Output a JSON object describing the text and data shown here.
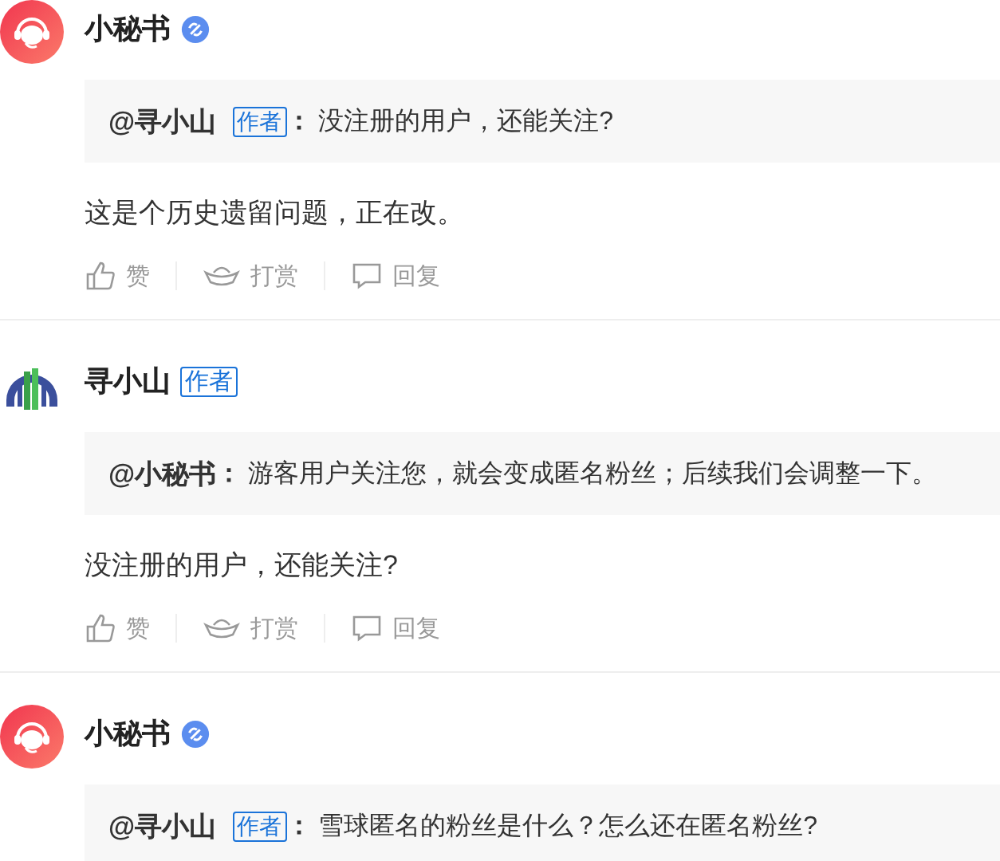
{
  "comments": [
    {
      "avatar": {
        "kind": "assistant"
      },
      "name": "小秘书",
      "verified": true,
      "quote": {
        "mention": "@寻小山",
        "badge": "作者",
        "colon": "：",
        "text": "没注册的用户，还能关注?"
      },
      "body": "这是个历史遗留问题，正在改。",
      "actions": [
        {
          "kind": "like",
          "label": "赞"
        },
        {
          "kind": "reward",
          "label": "打赏"
        },
        {
          "kind": "reply",
          "label": "回复"
        }
      ]
    },
    {
      "avatar": {
        "kind": "building"
      },
      "name": "寻小山",
      "verified": false,
      "author_badge": "作者",
      "quote": {
        "mention": "@小秘书",
        "colon": "：",
        "text": "游客用户关注您，就会变成匿名粉丝；后续我们会调整一下。"
      },
      "body": "没注册的用户，还能关注?",
      "actions": [
        {
          "kind": "like",
          "label": "赞"
        },
        {
          "kind": "reward",
          "label": "打赏"
        },
        {
          "kind": "reply",
          "label": "回复"
        }
      ]
    },
    {
      "avatar": {
        "kind": "assistant"
      },
      "name": "小秘书",
      "verified": true,
      "quote": {
        "mention": "@寻小山",
        "badge": "作者",
        "colon": "：",
        "text": "雪球匿名的粉丝是什么？怎么还在匿名粉丝?"
      }
    }
  ]
}
